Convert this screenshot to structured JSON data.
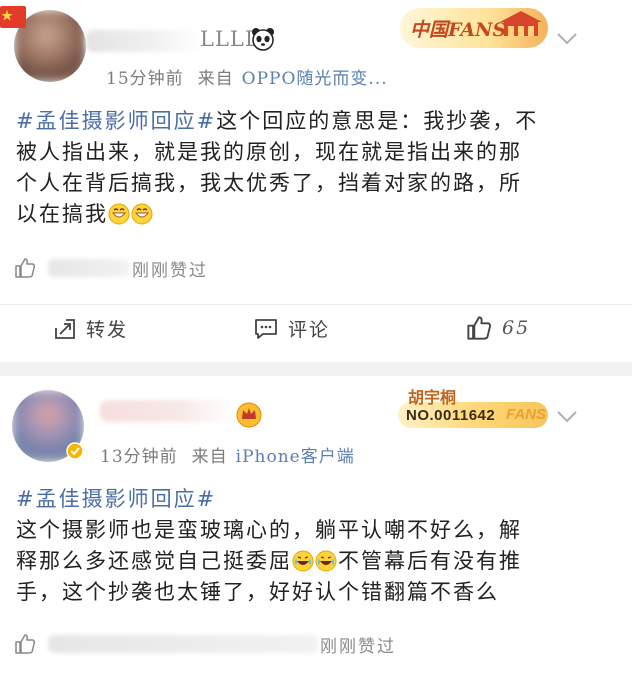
{
  "post1": {
    "username_suffix": "LLLL",
    "time": "15分钟前",
    "from_label": "来自",
    "source": "OPPO随光而变...",
    "badge_text": "中国FANS",
    "hashtag": "#孟佳摄影师回应#",
    "body_lines": [
      "这个回应的意思是：我抄袭，不",
      "被人指出来，就是我的原创，现在就是指出来的那",
      "个人在背后搞我，我太优秀了，挡着对家的路，所",
      "以在搞我"
    ],
    "liked_text": "刚刚赞过",
    "actions": {
      "repost": "转发",
      "comment": "评论",
      "like_count": "65"
    }
  },
  "post2": {
    "time": "13分钟前",
    "from_label": "来自",
    "source": "iPhone客户端",
    "badge_name": "胡宇桐",
    "badge_no": "NO.0011642",
    "badge_fans": "FANS",
    "hashtag": "#孟佳摄影师回应#",
    "body_lines": [
      "这个摄影师也是蛮玻璃心的，躺平认嘲不好么，解",
      "释那么多还感觉自己挺委屈",
      "不管幕后有没有推",
      "手，这个抄袭也太锤了，好好认个错翻篇不香么"
    ],
    "liked_text": "刚刚赞过"
  },
  "colors": {
    "hashtag": "#4b6ea7",
    "meta": "#7c7c7c",
    "source_link": "#5a7fb1",
    "badge_red": "#c24a1a",
    "badge_gold": "#f3c561"
  }
}
